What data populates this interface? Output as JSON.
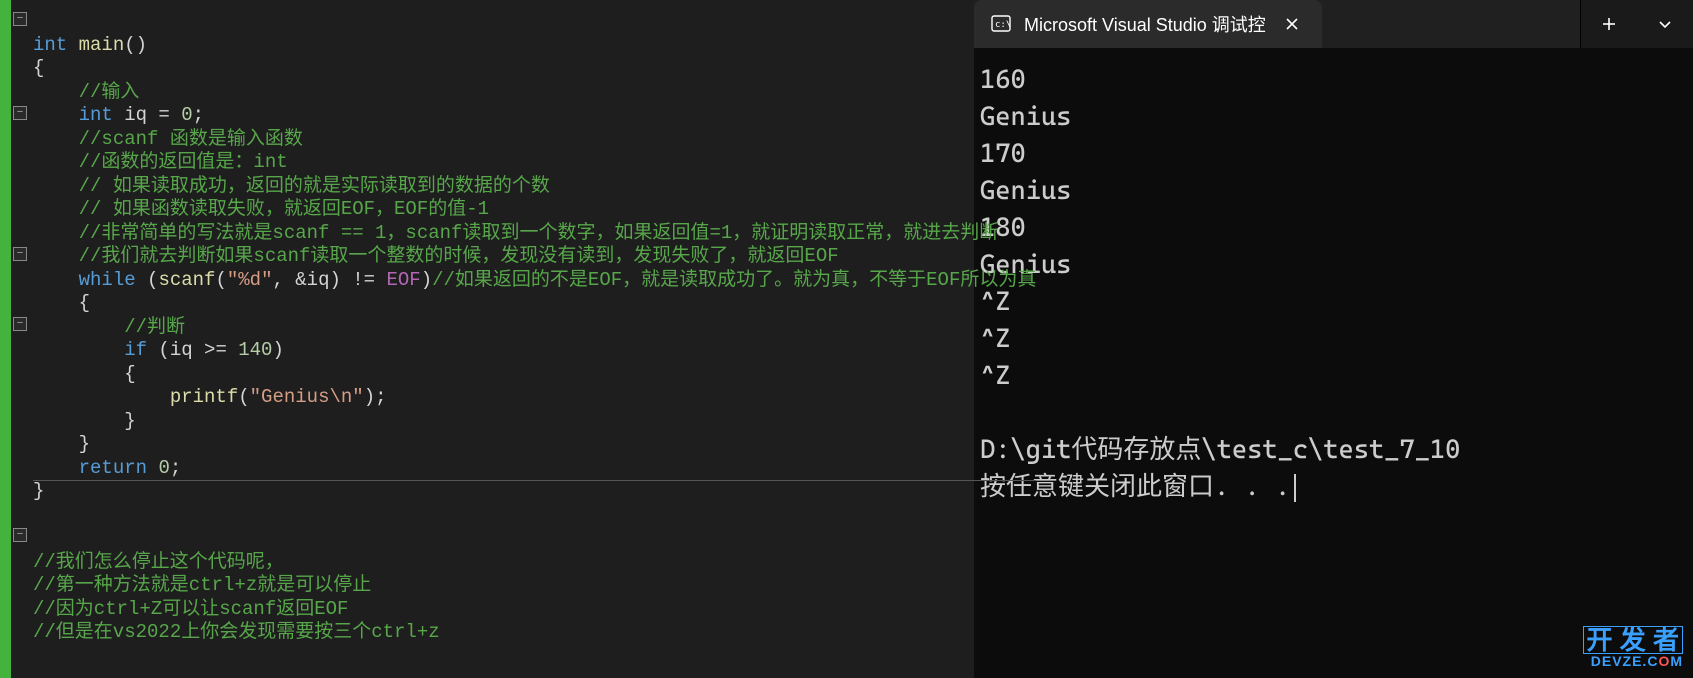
{
  "editor": {
    "fold_marks": [
      {
        "line": 0,
        "symbol": "−"
      },
      {
        "line": 4,
        "symbol": "−"
      },
      {
        "line": 10,
        "symbol": "−"
      },
      {
        "line": 13,
        "symbol": "−"
      },
      {
        "line": 22,
        "symbol": "−"
      }
    ],
    "code": {
      "l0_kw_int": "int",
      "l0_fn_main": "main",
      "l0_paren": "()",
      "l1_brace": "{",
      "l2_cmt": "//输入",
      "l3_kw_int": "int",
      "l3_var": " iq = ",
      "l3_num": "0",
      "l3_semi": ";",
      "l4_cmt": "//scanf 函数是输入函数",
      "l5_cmt": "//函数的返回值是：int",
      "l6_cmt": "// 如果读取成功，返回的就是实际读取到的数据的个数",
      "l7_cmt": "// 如果函数读取失败，就返回EOF，EOF的值-1",
      "l8_cmt": "//非常简单的写法就是scanf == 1，scanf读取到一个数字，如果返回值=1，就证明读取正常，就进去判断",
      "l9_cmt": "//我们就去判断如果scanf读取一个整数的时候，发现没有读到，发现失败了，就返回EOF",
      "l10_kw_while": "while",
      "l10_lp": " (",
      "l10_fn_scanf": "scanf",
      "l10_args_open": "(",
      "l10_str_fmt": "\"%d\"",
      "l10_comma": ", &iq) != ",
      "l10_eof": "EOF",
      "l10_rp": ")",
      "l10_cmt": "//如果返回的不是EOF，就是读取成功了。就为真，不等于EOF所以为真",
      "l11_brace": "{",
      "l12_cmt": "//判断",
      "l13_kw_if": "if",
      "l13_cond_open": " (iq >= ",
      "l13_num": "140",
      "l13_cond_close": ")",
      "l14_brace": "{",
      "l15_fn_printf": "printf",
      "l15_open": "(",
      "l15_str": "\"Genius\\n\"",
      "l15_close": ");",
      "l16_brace": "}",
      "l17_brace": "}",
      "l18_kw_return": "return",
      "l18_sp": " ",
      "l18_num": "0",
      "l18_semi": ";",
      "l19_brace": "}"
    },
    "bottom_comments": {
      "c0": "//我们怎么停止这个代码呢，",
      "c1": "//第一种方法就是ctrl+z就是可以停止",
      "c2": "//因为ctrl+Z可以让scanf返回EOF",
      "c3": "//但是在vs2022上你会发现需要按三个ctrl+z"
    }
  },
  "console": {
    "tab_title": "Microsoft Visual Studio 调试控",
    "output": [
      "160",
      "Genius",
      "170",
      "Genius",
      "180",
      "Genius",
      "^Z",
      "^Z",
      "^Z",
      "",
      "D:\\git代码存放点\\test_c\\test_7_10",
      "按任意键关闭此窗口. . ."
    ]
  },
  "watermark": {
    "line1": "开 发 者",
    "line2_pre": "DEVZE.C",
    "line2_o": "O",
    "line2_m": "M"
  }
}
